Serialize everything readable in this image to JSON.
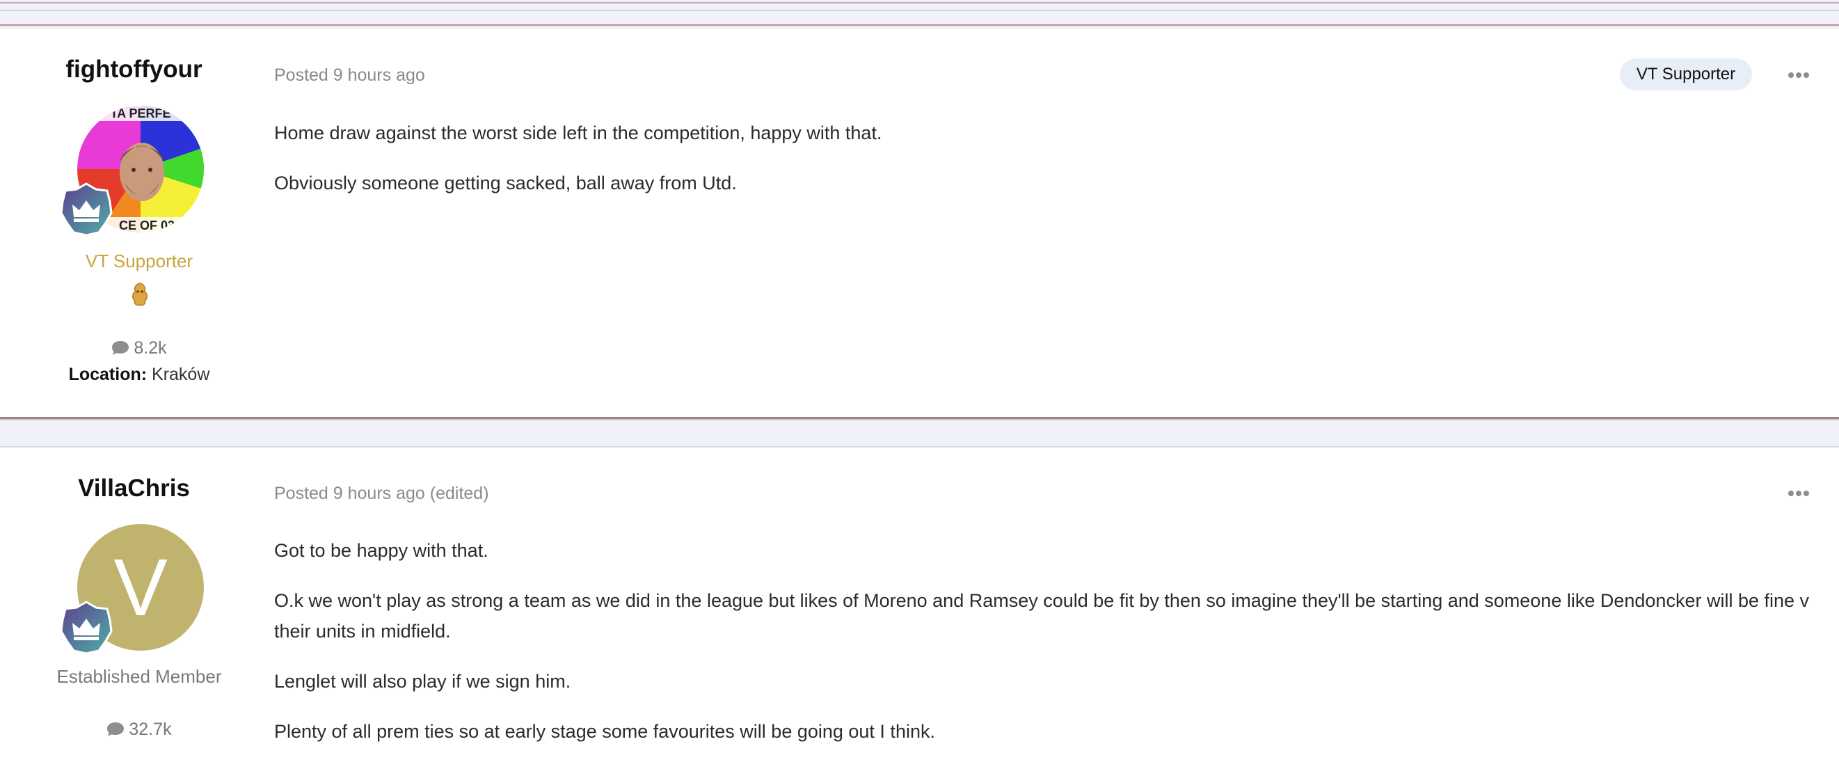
{
  "posts": [
    {
      "author": "fightoffyour",
      "rank": "VT Supporter",
      "post_count": "8.2k",
      "location_label": "Location:",
      "location": "Kraków",
      "posted": "Posted 9 hours ago",
      "badge_pill": "VT Supporter",
      "paragraphs": [
        "Home draw against the worst side left in the competition, happy with that.",
        "Obviously someone getting sacked, ball away from Utd."
      ]
    },
    {
      "author": "VillaChris",
      "avatar_letter": "V",
      "rank": "Established Member",
      "post_count": "32.7k",
      "posted": "Posted 9 hours ago (edited)",
      "paragraphs": [
        "Got to be happy with that.",
        "O.k we won't play as strong a team as we did in the league but likes of Moreno and Ramsey could be fit by then so imagine they'll be starting and someone like Dendoncker will be fine v their units in midfield.",
        "Lenglet will also play if we sign him.",
        "Plenty of all prem ties so at early stage some favourites will be going out I think."
      ]
    }
  ],
  "colors": {
    "rank_supporter": "#c9a43a",
    "rank_member": "#7a7a7a",
    "letter_avatar_bg": "#bfb36e",
    "pill_bg": "#e8eef7"
  },
  "icons": {
    "post_count": "speech-bubble-icon",
    "badge": "crown-badge-icon",
    "supporter_emblem": "lion-emblem-icon",
    "menu": "more-options-icon"
  }
}
